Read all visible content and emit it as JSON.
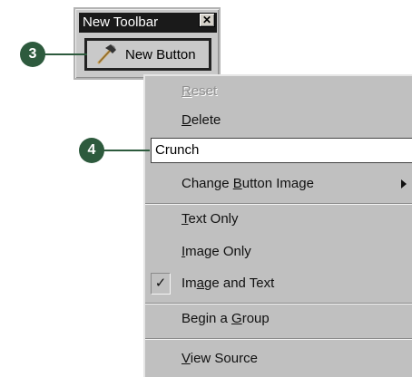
{
  "toolbar": {
    "title": "New Toolbar",
    "close_glyph": "✕",
    "button_label": "New Button",
    "button_icon": "hammer-icon"
  },
  "callouts": {
    "step3": "3",
    "step4": "4"
  },
  "menu": {
    "reset_prefix": "",
    "reset_key": "R",
    "reset_rest": "eset",
    "delete_key": "D",
    "delete_rest": "elete",
    "name_value": "Crunch",
    "change_image_pre": "Change ",
    "change_image_key": "B",
    "change_image_rest": "utton Image",
    "text_only_key": "T",
    "text_only_rest": "ext Only",
    "image_only_key": "I",
    "image_only_rest": "mage Only",
    "image_text_pre": "Im",
    "image_text_key": "a",
    "image_text_rest": "ge and Text",
    "image_text_checked": "✓",
    "begin_group_pre": "Begin a ",
    "begin_group_key": "G",
    "begin_group_rest": "roup",
    "view_source_key": "V",
    "view_source_rest": "iew Source"
  },
  "colors": {
    "callout": "#2d5a3d",
    "menu_bg": "#c0c0c0",
    "title_bg": "#1a1a1a"
  }
}
